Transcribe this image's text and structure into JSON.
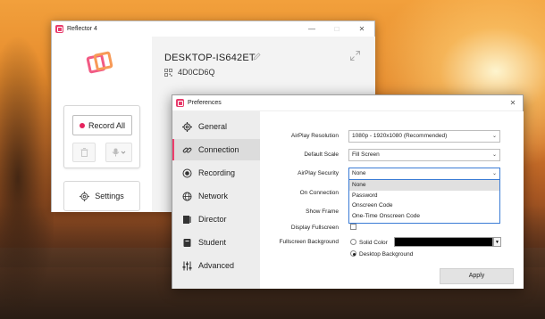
{
  "desktop": {
    "scene": "sunset-wallpaper"
  },
  "reflector": {
    "title": "Reflector 4",
    "record_all": "Record All",
    "settings": "Settings",
    "device_name": "DESKTOP-IS642ET",
    "device_code": "4D0CD6Q",
    "icons": [
      "reflector-logo",
      "record-dot",
      "trash-icon",
      "mic-icon",
      "gear-icon",
      "pencil-icon",
      "qr-icon",
      "expand-icon"
    ]
  },
  "preferences": {
    "title": "Preferences",
    "nav": [
      {
        "label": "General",
        "icon": "gear-icon"
      },
      {
        "label": "Connection",
        "icon": "link-icon"
      },
      {
        "label": "Recording",
        "icon": "record-icon"
      },
      {
        "label": "Network",
        "icon": "globe-icon"
      },
      {
        "label": "Director",
        "icon": "director-icon"
      },
      {
        "label": "Student",
        "icon": "student-icon"
      },
      {
        "label": "Advanced",
        "icon": "sliders-icon"
      }
    ],
    "active_nav": "Connection",
    "rows": {
      "airplay_resolution": {
        "label": "AirPlay Resolution",
        "value": "1080p - 1920x1080 (Recommended)"
      },
      "default_scale": {
        "label": "Default Scale",
        "value": "Fill Screen"
      },
      "airplay_security": {
        "label": "AirPlay Security",
        "value": "None"
      },
      "on_connection": {
        "label": "On Connection"
      },
      "show_frame": {
        "label": "Show Frame"
      },
      "display_fullscreen": {
        "label": "Display Fullscreen"
      },
      "fullscreen_background": {
        "label": "Fullscreen Background"
      }
    },
    "security_options": [
      "None",
      "Password",
      "Onscreen Code",
      "One-Time Onscreen Code"
    ],
    "background_options": {
      "solid_color": "Solid Color",
      "desktop_background": "Desktop Background"
    },
    "apply": "Apply"
  },
  "colors": {
    "accent": "#ee3e6d",
    "record": "#e6245e",
    "logo_pink": "#f25b84",
    "logo_orange": "#f79a57"
  }
}
